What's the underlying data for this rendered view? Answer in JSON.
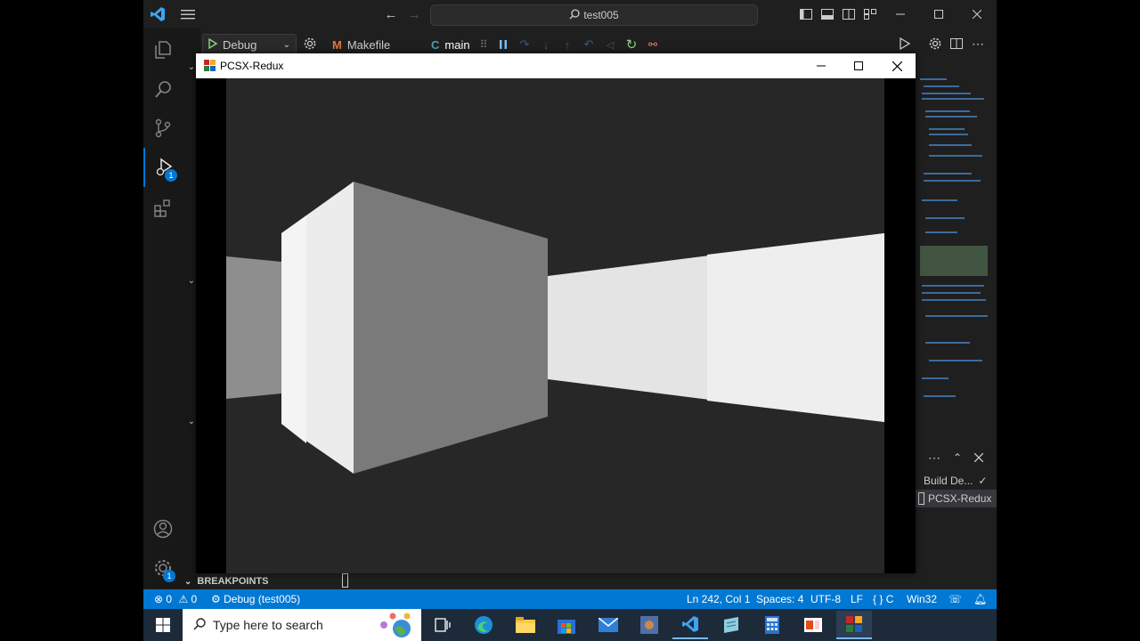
{
  "search": {
    "label": "test005"
  },
  "debug_toolbar": {
    "config_label": "Debug"
  },
  "editor_tabs": [
    {
      "label": "Makefile",
      "icon": "M"
    },
    {
      "label": "main",
      "icon": "C"
    }
  ],
  "pcsx_window": {
    "title": "PCSX-Redux"
  },
  "sidebar": {
    "breakpoints_label": "BREAKPOINTS"
  },
  "activity_badges": {
    "run_debug": "1",
    "manage": "1"
  },
  "panel": {
    "items": [
      {
        "label": "Build De..."
      },
      {
        "label": "PCSX-Redux"
      }
    ]
  },
  "statusbar": {
    "errors": "0",
    "warnings": "0",
    "debug_label": "Debug (test005)",
    "position": "Ln 242, Col 1",
    "spaces": "Spaces: 4",
    "encoding": "UTF-8",
    "eol": "LF",
    "language": "C",
    "platform": "Win32"
  },
  "taskbar": {
    "search_placeholder": "Type here to search"
  },
  "colors": {
    "accent": "#0078d4",
    "editor_bg": "#1f1f1f",
    "game_bg": "#272727"
  }
}
